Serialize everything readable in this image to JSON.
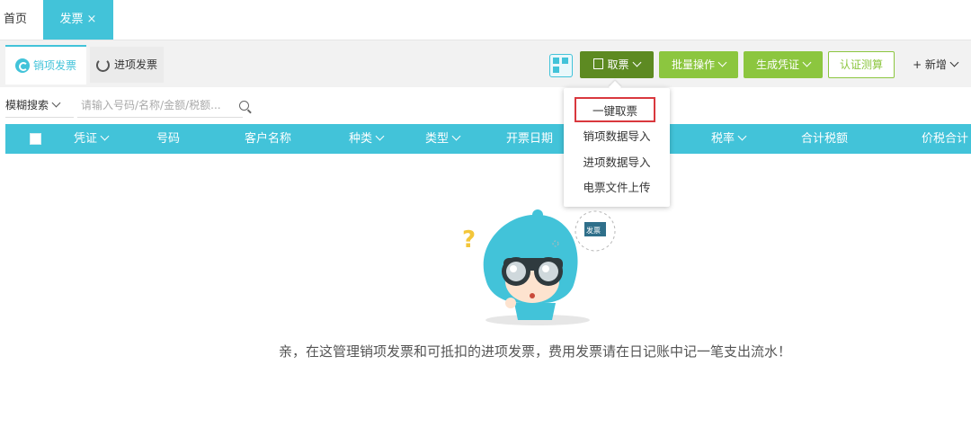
{
  "tabs": [
    {
      "label": "首页"
    },
    {
      "label": "发票",
      "close": "×"
    }
  ],
  "subtabs": [
    {
      "label": "销项发票"
    },
    {
      "label": "进项发票"
    }
  ],
  "toolbar": {
    "fetch_label": "取票",
    "batch_label": "批量操作",
    "voucher_label": "生成凭证",
    "cert_label": "认证测算",
    "new_label": "+ 新增"
  },
  "search": {
    "mode": "模糊搜索",
    "placeholder": "请输入号码/名称/金额/税额..."
  },
  "table": {
    "columns": [
      "凭证",
      "号码",
      "客户名称",
      "种类",
      "类型",
      "开票日期",
      "税率",
      "合计税额",
      "价税合计"
    ]
  },
  "dropdown": {
    "items": [
      "一键取票",
      "销项数据导入",
      "进项数据导入",
      "电票文件上传"
    ]
  },
  "empty_state": {
    "badge": "发票",
    "message": "亲，在这管理销项发票和可抵扣的进项发票，费用发票请在日记账中记一笔支出流水！"
  },
  "colors": {
    "accent": "#42c3d9",
    "fetch_button": "#5d8a22",
    "green_button": "#8cc63f",
    "highlight_border": "#d9383e"
  }
}
